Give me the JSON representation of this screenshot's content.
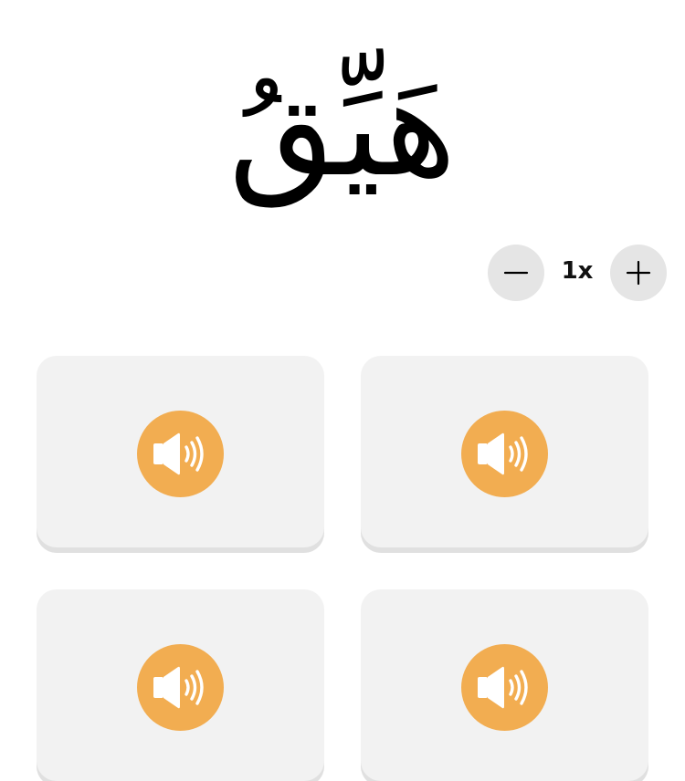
{
  "prompt": {
    "word": "هَيِّقُ"
  },
  "playback": {
    "speed_label": "1x",
    "minus_icon": "minus-icon",
    "plus_icon": "plus-icon"
  },
  "options": [
    {
      "icon": "speaker-icon"
    },
    {
      "icon": "speaker-icon"
    },
    {
      "icon": "speaker-icon"
    },
    {
      "icon": "speaker-icon"
    }
  ],
  "colors": {
    "card_background": "#f2f2f2",
    "card_shadow": "#e0e0e0",
    "audio_accent": "#f2ad51",
    "control_background": "#e5e5e5",
    "text": "#000000"
  }
}
